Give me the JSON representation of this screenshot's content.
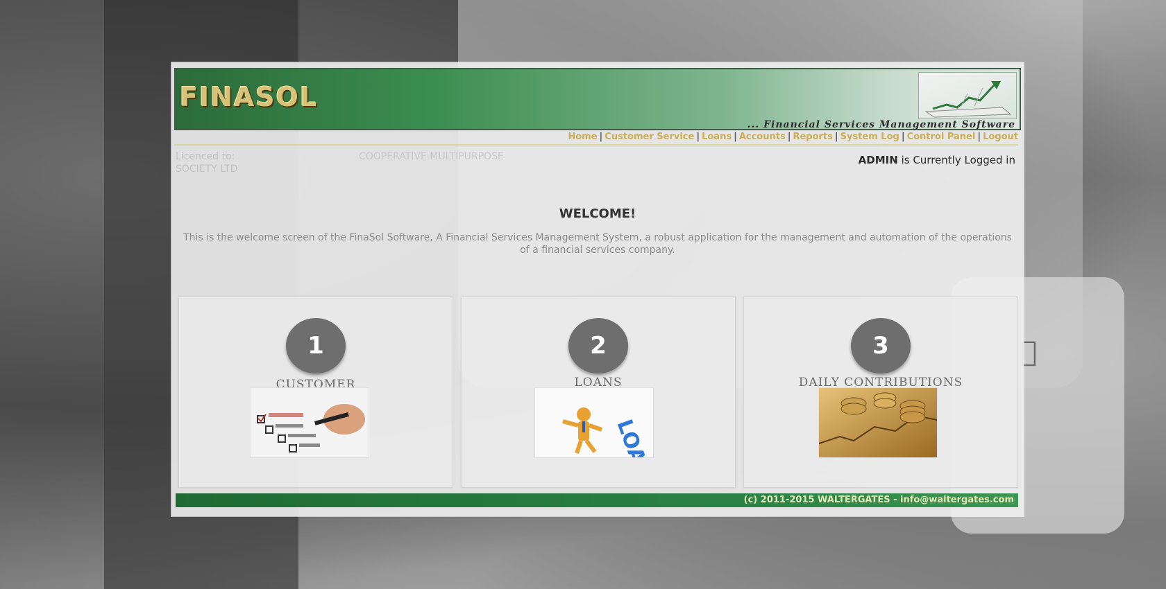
{
  "app": {
    "logo": "FINASOL",
    "tagline": "... Financial Services Management Software"
  },
  "nav": {
    "items": [
      "Home",
      "Customer Service",
      "Loans",
      "Accounts",
      "Reports",
      "System Log",
      "Control Panel",
      "Logout"
    ]
  },
  "license": {
    "line1": "Licenced to:",
    "line2": "SOCIETY LTD",
    "org": "COOPERATIVE MULTIPURPOSE"
  },
  "user": {
    "name": "ADMIN",
    "status": "is Currently Logged in"
  },
  "welcome": {
    "title": "WELCOME!",
    "text": "This is the welcome screen of the FinaSol Software, A Financial Services Management System, a robust application for the management and automation of the operations of a financial services company."
  },
  "cards": [
    {
      "number": "1",
      "title": "CUSTOMER",
      "icon": "checklist-icon"
    },
    {
      "number": "2",
      "title": "LOANS",
      "icon": "loan-man-icon"
    },
    {
      "number": "3",
      "title": "DAILY CONTRIBUTIONS",
      "icon": "coins-chart-icon"
    }
  ],
  "footer": {
    "text": "(c) 2011-2015 WALTERGATES - info@waltergates.com"
  },
  "colors": {
    "banner_green": "#2b6b3a",
    "nav_gold": "#c9ae55",
    "footer_green": "#1f6b35"
  }
}
